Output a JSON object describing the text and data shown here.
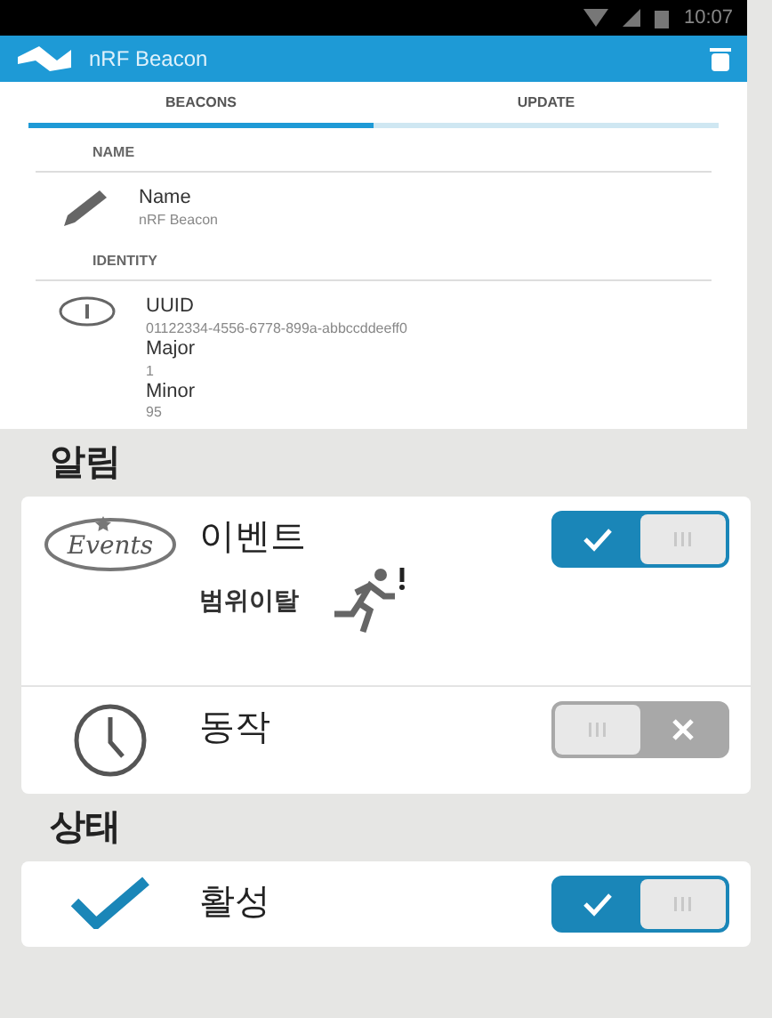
{
  "status_bar": {
    "time": "10:07"
  },
  "app_bar": {
    "title": "nRF Beacon"
  },
  "tabs": [
    {
      "label": "BEACONS",
      "selected": true
    },
    {
      "label": "UPDATE",
      "selected": false
    }
  ],
  "sections": [
    {
      "header": "NAME",
      "items": [
        {
          "kind": "pencil",
          "fields": [
            {
              "label": "Name",
              "value": "nRF Beacon"
            }
          ]
        }
      ]
    },
    {
      "header": "IDENTITY",
      "items": [
        {
          "kind": "info",
          "fields": [
            {
              "label": "UUID",
              "value": "01122334-4556-6778-899a-abbccddeeff0"
            },
            {
              "label": "Major",
              "value": "1"
            },
            {
              "label": "Minor",
              "value": "95"
            }
          ]
        }
      ]
    }
  ],
  "settings": [
    {
      "heading": "알림",
      "rows": [
        {
          "kind": "events",
          "logo_text": "Events",
          "label": "이벤트",
          "sublabel": "범위이탈",
          "on": true
        },
        {
          "kind": "clock",
          "label": "동작",
          "on": false
        }
      ]
    },
    {
      "heading": "상태",
      "rows": [
        {
          "kind": "check",
          "label": "활성",
          "on": true
        }
      ]
    }
  ]
}
